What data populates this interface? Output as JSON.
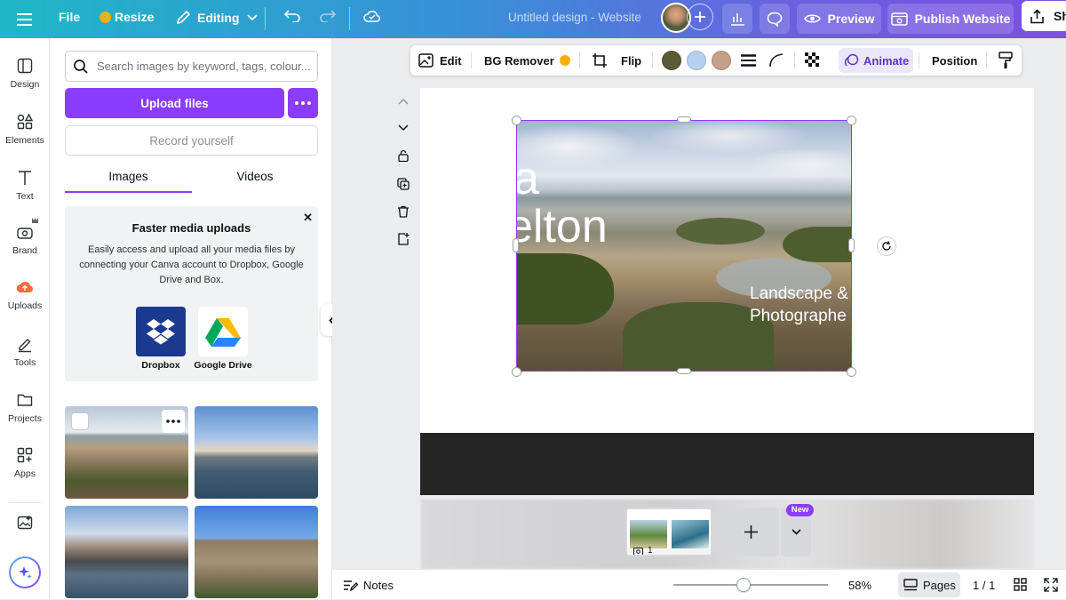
{
  "topbar": {
    "file": "File",
    "resize": "Resize",
    "editing": "Editing",
    "doc_title": "Untitled design - Website",
    "preview": "Preview",
    "publish": "Publish Website",
    "share": "Sh"
  },
  "sidebar": {
    "items": [
      {
        "label": "Design",
        "icon": "layout-icon"
      },
      {
        "label": "Elements",
        "icon": "shapes-icon"
      },
      {
        "label": "Text",
        "icon": "text-icon"
      },
      {
        "label": "Brand",
        "icon": "brand-icon"
      },
      {
        "label": "Uploads",
        "icon": "cloud-upload-icon"
      },
      {
        "label": "Tools",
        "icon": "pen-icon"
      },
      {
        "label": "Projects",
        "icon": "folder-icon"
      },
      {
        "label": "Apps",
        "icon": "apps-icon"
      }
    ]
  },
  "panel": {
    "search_placeholder": "Search images by keyword, tags, colour...",
    "upload_label": "Upload files",
    "record_label": "Record yourself",
    "tabs": [
      "Images",
      "Videos"
    ],
    "promo": {
      "title": "Faster media uploads",
      "body": "Easily access and upload all your media files by connecting your Canva account to Dropbox, Google Drive and Box.",
      "dropbox": "Dropbox",
      "gdrive": "Google Drive"
    }
  },
  "toolbar": {
    "edit": "Edit",
    "bg_remover": "BG Remover",
    "flip": "Flip",
    "animate": "Animate",
    "position": "Position",
    "colors": [
      "#5b5a36",
      "#b7cfee",
      "#c4a08a"
    ]
  },
  "canvas": {
    "heading_part1": "a",
    "heading_part2": "elton",
    "subtitle_line1": "Landscape &",
    "subtitle_line2": "Photographe"
  },
  "pages_strip": {
    "new_badge": "New",
    "page_number": "1"
  },
  "bottombar": {
    "notes": "Notes",
    "zoom": "58%",
    "pages": "Pages",
    "page_count": "1 / 1"
  }
}
